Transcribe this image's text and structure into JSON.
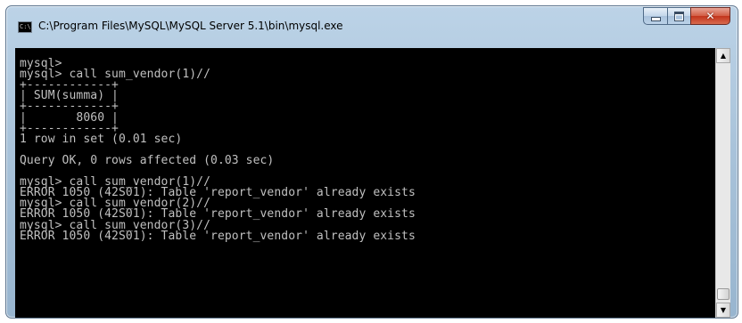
{
  "window": {
    "title": "C:\\Program Files\\MySQL\\MySQL Server 5.1\\bin\\mysql.exe",
    "icon": "console-icon",
    "controls": {
      "minimize": "minimize-icon",
      "maximize": "maximize-icon",
      "close": "✕"
    }
  },
  "terminal": {
    "lines": [
      "",
      "mysql>",
      "mysql> call sum_vendor(1)//",
      "+------------+",
      "| SUM(summa) |",
      "+------------+",
      "|       8060 |",
      "+------------+",
      "1 row in set (0.01 sec)",
      "",
      "Query OK, 0 rows affected (0.03 sec)",
      "",
      "mysql> call sum_vendor(1)//",
      "ERROR 1050 (42S01): Table 'report_vendor' already exists",
      "mysql> call sum_vendor(2)//",
      "ERROR 1050 (42S01): Table 'report_vendor' already exists",
      "mysql> call sum_vendor(3)//",
      "ERROR 1050 (42S01): Table 'report_vendor' already exists"
    ]
  },
  "scrollbar": {
    "up_arrow": "▲",
    "down_arrow": "▼"
  },
  "colors": {
    "console_bg": "#000000",
    "console_fg": "#c0c0c0",
    "close_button": "#c7432a"
  }
}
